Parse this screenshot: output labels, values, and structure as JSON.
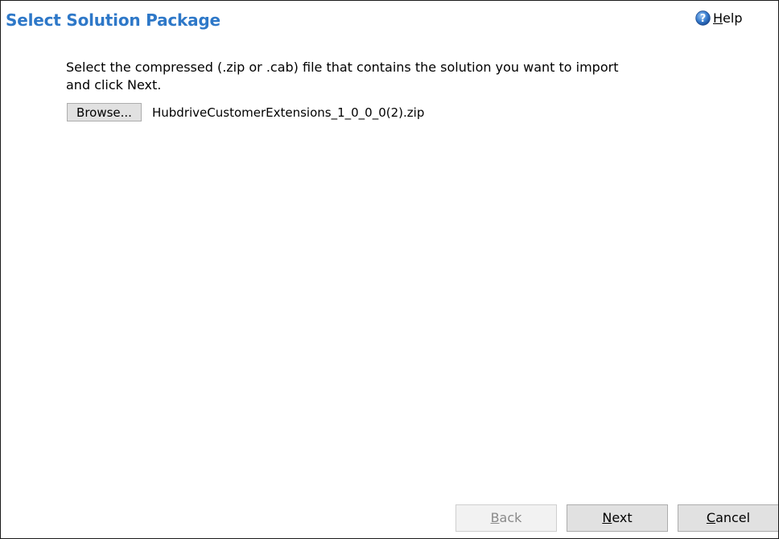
{
  "header": {
    "title": "Select Solution Package",
    "help_mnemonic": "H",
    "help_rest": "elp",
    "help_icon": "help-question-icon"
  },
  "content": {
    "instruction": "Select the compressed (.zip or .cab) file that contains the solution you want to import and click Next.",
    "browse_label": "Browse...",
    "selected_file": "HubdriveCustomerExtensions_1_0_0_0(2).zip"
  },
  "footer": {
    "back_mnemonic": "B",
    "back_rest": "ack",
    "next_mnemonic": "N",
    "next_rest": "ext",
    "cancel_mnemonic": "C",
    "cancel_rest": "ancel"
  },
  "colors": {
    "title": "#2e78c8",
    "button_face": "#e1e1e1",
    "disabled_text": "#8a8a8a"
  }
}
